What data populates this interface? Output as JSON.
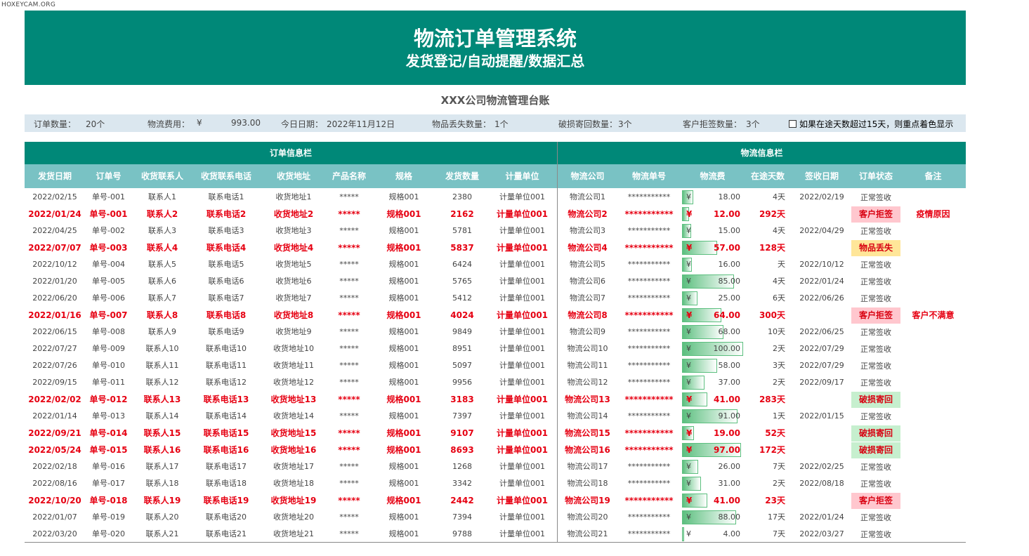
{
  "watermark": "HOXEYCAM.ORG",
  "banner": {
    "title": "物流订单管理系统",
    "subtitle": "发货登记/自动提醒/数据汇总"
  },
  "ledger_title": "XXX公司物流管理台账",
  "summary": {
    "order_count_label": "订单数量：",
    "order_count": "20个",
    "fee_label": "物流费用：",
    "fee_currency": "¥",
    "fee_value": "993.00",
    "today_label": "今日日期：",
    "today": "2022年11月12日",
    "lost_label": "物品丢失数量：",
    "lost": "1个",
    "damage_label": "破损寄回数量：",
    "damage": "3个",
    "reject_label": "客户拒签数量：",
    "reject": "3个",
    "checkbox_note": "如果在途天数超过15天，则重点着色显示"
  },
  "groups": {
    "order": "订单信息栏",
    "logistics": "物流信息栏"
  },
  "columns": [
    "发货日期",
    "订单号",
    "收货联系人",
    "收货联系电话",
    "收货地址",
    "产品名称",
    "规格",
    "发货数量",
    "计量单位",
    "物流公司",
    "物流单号",
    "物流费",
    "在途天数",
    "签收日期",
    "订单状态",
    "备注"
  ],
  "colors": {
    "banner": "#008878",
    "header": "#79c2c4",
    "highlight": "#e60012",
    "reject_bg": "#ffc7ce",
    "lost_bg": "#ffe699",
    "damage_bg": "#c6efce",
    "fee_bar": "#5cbf7f"
  },
  "rows": [
    {
      "date": "2022/02/15",
      "order": "单号-001",
      "contact": "联系人1",
      "phone": "联系电话1",
      "addr": "收货地址1",
      "product": "*****",
      "spec": "规格001",
      "qty": "2380",
      "unit": "计量单位001",
      "company": "物流公司1",
      "track": "***********",
      "fee": "18.00",
      "days": "4天",
      "sign": "2022/02/19",
      "status": "正常签收",
      "note": "",
      "hl": false,
      "st": ""
    },
    {
      "date": "2022/01/24",
      "order": "单号-001",
      "contact": "联系人2",
      "phone": "联系电话2",
      "addr": "收货地址2",
      "product": "*****",
      "spec": "规格001",
      "qty": "2162",
      "unit": "计量单位001",
      "company": "物流公司2",
      "track": "***********",
      "fee": "12.00",
      "days": "292天",
      "sign": "",
      "status": "客户拒签",
      "note": "疫情原因",
      "hl": true,
      "st": "pink"
    },
    {
      "date": "2022/04/25",
      "order": "单号-002",
      "contact": "联系人3",
      "phone": "联系电话3",
      "addr": "收货地址3",
      "product": "*****",
      "spec": "规格001",
      "qty": "5781",
      "unit": "计量单位001",
      "company": "物流公司3",
      "track": "***********",
      "fee": "15.00",
      "days": "4天",
      "sign": "2022/04/29",
      "status": "正常签收",
      "note": "",
      "hl": false,
      "st": ""
    },
    {
      "date": "2022/07/07",
      "order": "单号-003",
      "contact": "联系人4",
      "phone": "联系电话4",
      "addr": "收货地址4",
      "product": "*****",
      "spec": "规格001",
      "qty": "5837",
      "unit": "计量单位001",
      "company": "物流公司4",
      "track": "***********",
      "fee": "57.00",
      "days": "128天",
      "sign": "",
      "status": "物品丢失",
      "note": "",
      "hl": true,
      "st": "yellow"
    },
    {
      "date": "2022/10/12",
      "order": "单号-004",
      "contact": "联系人5",
      "phone": "联系电话5",
      "addr": "收货地址5",
      "product": "*****",
      "spec": "规格001",
      "qty": "6424",
      "unit": "计量单位001",
      "company": "物流公司5",
      "track": "***********",
      "fee": "16.00",
      "days": "天",
      "sign": "2022/10/12",
      "status": "正常签收",
      "note": "",
      "hl": false,
      "st": ""
    },
    {
      "date": "2022/01/20",
      "order": "单号-005",
      "contact": "联系人6",
      "phone": "联系电话6",
      "addr": "收货地址6",
      "product": "*****",
      "spec": "规格001",
      "qty": "5765",
      "unit": "计量单位001",
      "company": "物流公司6",
      "track": "***********",
      "fee": "85.00",
      "days": "4天",
      "sign": "2022/01/24",
      "status": "正常签收",
      "note": "",
      "hl": false,
      "st": ""
    },
    {
      "date": "2022/06/20",
      "order": "单号-006",
      "contact": "联系人7",
      "phone": "联系电话7",
      "addr": "收货地址7",
      "product": "*****",
      "spec": "规格001",
      "qty": "5412",
      "unit": "计量单位001",
      "company": "物流公司7",
      "track": "***********",
      "fee": "25.00",
      "days": "6天",
      "sign": "2022/06/26",
      "status": "正常签收",
      "note": "",
      "hl": false,
      "st": ""
    },
    {
      "date": "2022/01/16",
      "order": "单号-007",
      "contact": "联系人8",
      "phone": "联系电话8",
      "addr": "收货地址8",
      "product": "*****",
      "spec": "规格001",
      "qty": "4024",
      "unit": "计量单位001",
      "company": "物流公司8",
      "track": "***********",
      "fee": "64.00",
      "days": "300天",
      "sign": "",
      "status": "客户拒签",
      "note": "客户不满意",
      "hl": true,
      "st": "pink"
    },
    {
      "date": "2022/06/15",
      "order": "单号-008",
      "contact": "联系人9",
      "phone": "联系电话9",
      "addr": "收货地址9",
      "product": "*****",
      "spec": "规格001",
      "qty": "9849",
      "unit": "计量单位001",
      "company": "物流公司9",
      "track": "***********",
      "fee": "68.00",
      "days": "10天",
      "sign": "2022/06/25",
      "status": "正常签收",
      "note": "",
      "hl": false,
      "st": ""
    },
    {
      "date": "2022/07/27",
      "order": "单号-009",
      "contact": "联系人10",
      "phone": "联系电话10",
      "addr": "收货地址10",
      "product": "*****",
      "spec": "规格001",
      "qty": "8951",
      "unit": "计量单位001",
      "company": "物流公司10",
      "track": "***********",
      "fee": "100.00",
      "days": "2天",
      "sign": "2022/07/29",
      "status": "正常签收",
      "note": "",
      "hl": false,
      "st": ""
    },
    {
      "date": "2022/07/26",
      "order": "单号-010",
      "contact": "联系人11",
      "phone": "联系电话11",
      "addr": "收货地址11",
      "product": "*****",
      "spec": "规格001",
      "qty": "5097",
      "unit": "计量单位001",
      "company": "物流公司11",
      "track": "***********",
      "fee": "58.00",
      "days": "3天",
      "sign": "2022/07/29",
      "status": "正常签收",
      "note": "",
      "hl": false,
      "st": ""
    },
    {
      "date": "2022/09/15",
      "order": "单号-011",
      "contact": "联系人12",
      "phone": "联系电话12",
      "addr": "收货地址12",
      "product": "*****",
      "spec": "规格001",
      "qty": "9956",
      "unit": "计量单位001",
      "company": "物流公司12",
      "track": "***********",
      "fee": "37.00",
      "days": "2天",
      "sign": "2022/09/17",
      "status": "正常签收",
      "note": "",
      "hl": false,
      "st": ""
    },
    {
      "date": "2022/02/02",
      "order": "单号-012",
      "contact": "联系人13",
      "phone": "联系电话13",
      "addr": "收货地址13",
      "product": "*****",
      "spec": "规格001",
      "qty": "3183",
      "unit": "计量单位001",
      "company": "物流公司13",
      "track": "***********",
      "fee": "41.00",
      "days": "283天",
      "sign": "",
      "status": "破损寄回",
      "note": "",
      "hl": true,
      "st": "green"
    },
    {
      "date": "2022/01/14",
      "order": "单号-013",
      "contact": "联系人14",
      "phone": "联系电话14",
      "addr": "收货地址14",
      "product": "*****",
      "spec": "规格001",
      "qty": "7397",
      "unit": "计量单位001",
      "company": "物流公司14",
      "track": "***********",
      "fee": "91.00",
      "days": "1天",
      "sign": "2022/01/15",
      "status": "正常签收",
      "note": "",
      "hl": false,
      "st": ""
    },
    {
      "date": "2022/09/21",
      "order": "单号-014",
      "contact": "联系人15",
      "phone": "联系电话15",
      "addr": "收货地址15",
      "product": "*****",
      "spec": "规格001",
      "qty": "9107",
      "unit": "计量单位001",
      "company": "物流公司15",
      "track": "***********",
      "fee": "19.00",
      "days": "52天",
      "sign": "",
      "status": "破损寄回",
      "note": "",
      "hl": true,
      "st": "green"
    },
    {
      "date": "2022/05/24",
      "order": "单号-015",
      "contact": "联系人16",
      "phone": "联系电话16",
      "addr": "收货地址16",
      "product": "*****",
      "spec": "规格001",
      "qty": "8693",
      "unit": "计量单位001",
      "company": "物流公司16",
      "track": "***********",
      "fee": "97.00",
      "days": "172天",
      "sign": "",
      "status": "破损寄回",
      "note": "",
      "hl": true,
      "st": "green"
    },
    {
      "date": "2022/02/18",
      "order": "单号-016",
      "contact": "联系人17",
      "phone": "联系电话17",
      "addr": "收货地址17",
      "product": "*****",
      "spec": "规格001",
      "qty": "1268",
      "unit": "计量单位001",
      "company": "物流公司17",
      "track": "***********",
      "fee": "26.00",
      "days": "7天",
      "sign": "2022/02/25",
      "status": "正常签收",
      "note": "",
      "hl": false,
      "st": ""
    },
    {
      "date": "2022/08/16",
      "order": "单号-017",
      "contact": "联系人18",
      "phone": "联系电话18",
      "addr": "收货地址18",
      "product": "*****",
      "spec": "规格001",
      "qty": "3342",
      "unit": "计量单位001",
      "company": "物流公司18",
      "track": "***********",
      "fee": "31.00",
      "days": "2天",
      "sign": "2022/08/18",
      "status": "正常签收",
      "note": "",
      "hl": false,
      "st": ""
    },
    {
      "date": "2022/10/20",
      "order": "单号-018",
      "contact": "联系人19",
      "phone": "联系电话19",
      "addr": "收货地址19",
      "product": "*****",
      "spec": "规格001",
      "qty": "2442",
      "unit": "计量单位001",
      "company": "物流公司19",
      "track": "***********",
      "fee": "41.00",
      "days": "23天",
      "sign": "",
      "status": "客户拒签",
      "note": "",
      "hl": true,
      "st": "pink"
    },
    {
      "date": "2022/01/07",
      "order": "单号-019",
      "contact": "联系人20",
      "phone": "联系电话20",
      "addr": "收货地址20",
      "product": "*****",
      "spec": "规格001",
      "qty": "7394",
      "unit": "计量单位001",
      "company": "物流公司20",
      "track": "***********",
      "fee": "88.00",
      "days": "17天",
      "sign": "2022/01/24",
      "status": "正常签收",
      "note": "",
      "hl": false,
      "st": ""
    },
    {
      "date": "2022/03/20",
      "order": "单号-020",
      "contact": "联系人21",
      "phone": "联系电话21",
      "addr": "收货地址21",
      "product": "*****",
      "spec": "规格001",
      "qty": "9788",
      "unit": "计量单位001",
      "company": "物流公司21",
      "track": "***********",
      "fee": "4.00",
      "days": "7天",
      "sign": "2022/03/27",
      "status": "正常签收",
      "note": "",
      "hl": false,
      "st": ""
    }
  ]
}
